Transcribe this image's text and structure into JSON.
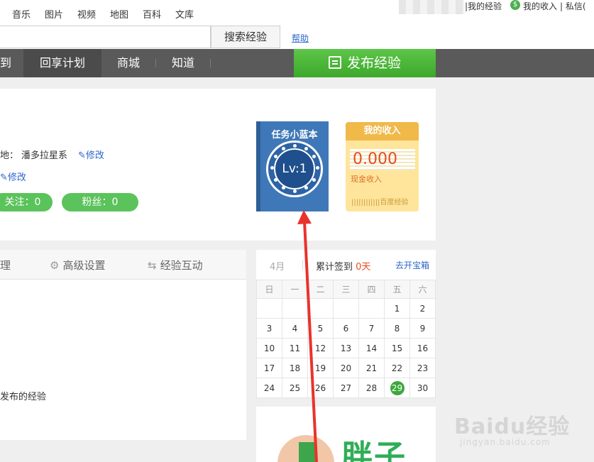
{
  "topbar": {
    "links": [
      "音乐",
      "图片",
      "视频",
      "地图",
      "百科",
      "文库"
    ],
    "user_links": [
      "|我的经验",
      "我的收入",
      "| 私信("
    ]
  },
  "search": {
    "placeholder": "",
    "button": "搜索经验",
    "help": "帮助"
  },
  "nav": {
    "items": [
      "到",
      "回享计划",
      "商城",
      "知道"
    ],
    "publish": "发布经验"
  },
  "profile": {
    "location_label": "地：",
    "location_value": "潘多拉星系",
    "edit": "修改",
    "edit2": "修改",
    "follow": "关注：0",
    "fans": "粉丝：0"
  },
  "task": {
    "title": "任务小蓝本",
    "level": "Lv:1"
  },
  "income": {
    "title": "我的收入",
    "amount": "0.000",
    "cash": "现金收入",
    "barcode": "||||||||||||百度经验"
  },
  "settings": {
    "tabs": [
      "理",
      "高级设置",
      "经验互动"
    ],
    "note": "发布的经验"
  },
  "calendar": {
    "month": "4月",
    "label": "累计签到",
    "days": "0天",
    "open": "去开宝箱",
    "weekdays": [
      "日",
      "一",
      "二",
      "三",
      "四",
      "五",
      "六"
    ],
    "weeks": [
      [
        "",
        "",
        "",
        "",
        "",
        "1",
        "2"
      ],
      [
        "3",
        "4",
        "5",
        "6",
        "7",
        "8",
        "9"
      ],
      [
        "10",
        "11",
        "12",
        "13",
        "14",
        "15",
        "16"
      ],
      [
        "17",
        "18",
        "19",
        "20",
        "21",
        "22",
        "23"
      ],
      [
        "24",
        "25",
        "26",
        "27",
        "28",
        "29",
        "30"
      ]
    ],
    "today": "29"
  },
  "ad": {
    "text": "胖子"
  },
  "watermark": {
    "main": "Baidu经验",
    "sub": "jingyan.baidu.com"
  },
  "colors": {
    "nav_bg": "#5a5a5a",
    "publish_green": "#4cb83a",
    "link_blue": "#2c65c9",
    "task_blue": "#3f78b8",
    "income_yellow": "#ffe59b",
    "arrow_red": "#e8332c"
  },
  "icons": [
    "edit-pencil-icon",
    "gear-icon",
    "exchange-icon",
    "dollar-icon",
    "publish-edit-icon",
    "red-arrow-annotation"
  ]
}
